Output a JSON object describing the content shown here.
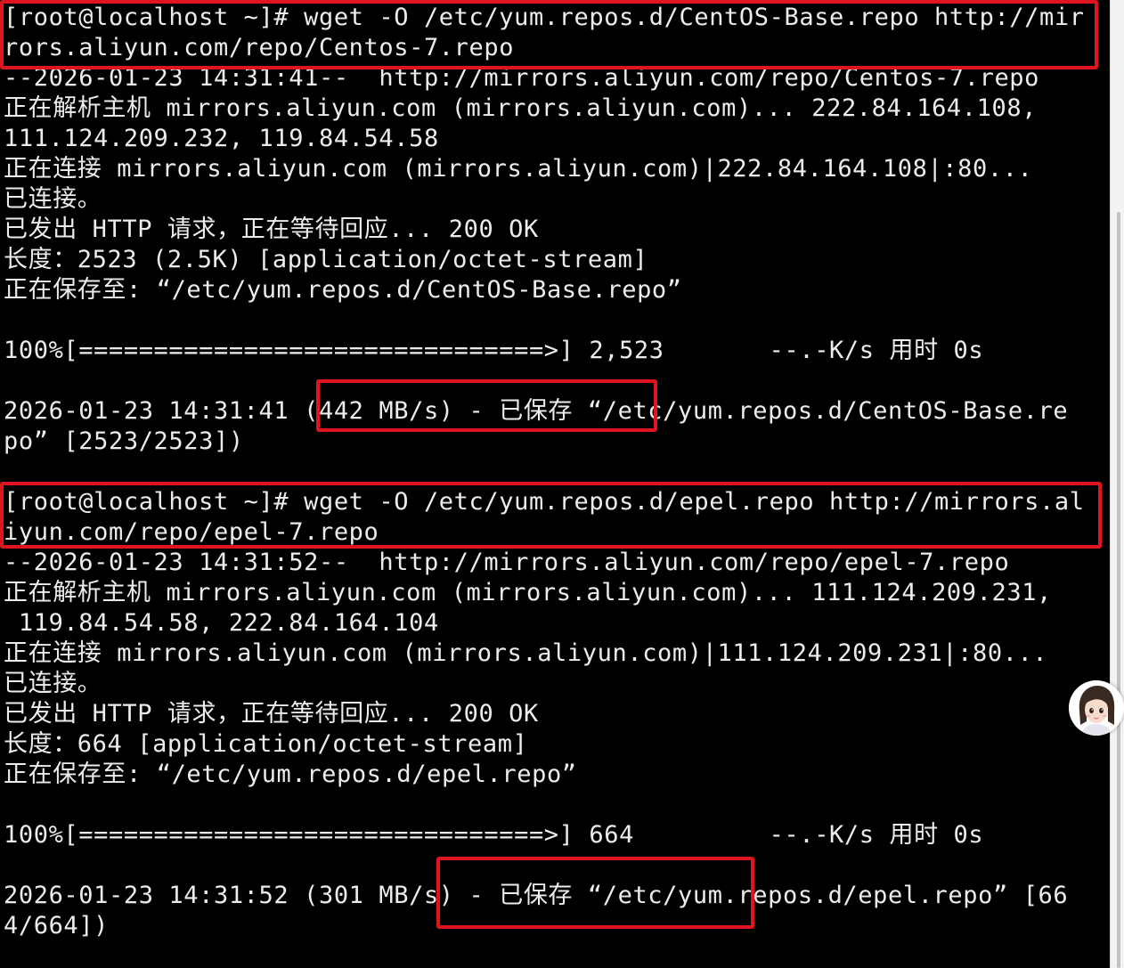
{
  "terminal": {
    "lines": [
      "[root@localhost ~]# wget -O /etc/yum.repos.d/CentOS-Base.repo http://mir",
      "rors.aliyun.com/repo/Centos-7.repo",
      "--2026-01-23 14:31:41--  http://mirrors.aliyun.com/repo/Centos-7.repo",
      "正在解析主机 mirrors.aliyun.com (mirrors.aliyun.com)... 222.84.164.108,",
      "111.124.209.232, 119.84.54.58",
      "正在连接 mirrors.aliyun.com (mirrors.aliyun.com)|222.84.164.108|:80...",
      "已连接。",
      "已发出 HTTP 请求，正在等待回应... 200 OK",
      "长度：2523 (2.5K) [application/octet-stream]",
      "正在保存至: “/etc/yum.repos.d/CentOS-Base.repo”",
      "",
      "100%[===============================>] 2,523       --.-K/s 用时 0s",
      "",
      "2026-01-23 14:31:41 (442 MB/s) - 已保存 “/etc/yum.repos.d/CentOS-Base.re",
      "po” [2523/2523])",
      "",
      "[root@localhost ~]# wget -O /etc/yum.repos.d/epel.repo http://mirrors.al",
      "iyun.com/repo/epel-7.repo",
      "--2026-01-23 14:31:52--  http://mirrors.aliyun.com/repo/epel-7.repo",
      "正在解析主机 mirrors.aliyun.com (mirrors.aliyun.com)... 111.124.209.231,",
      " 119.84.54.58, 222.84.164.104",
      "正在连接 mirrors.aliyun.com (mirrors.aliyun.com)|111.124.209.231|:80...",
      "已连接。",
      "已发出 HTTP 请求，正在等待回应... 200 OK",
      "长度：664 [application/octet-stream]",
      "正在保存至: “/etc/yum.repos.d/epel.repo”",
      "",
      "100%[===============================>] 664         --.-K/s 用时 0s",
      "",
      "2026-01-23 14:31:52 (301 MB/s) - 已保存 “/etc/yum.repos.d/epel.repo” [66",
      "4/664])"
    ],
    "colors": {
      "background": "#000000",
      "text": "#ececec",
      "highlight": "#e0141e"
    }
  },
  "icons": {
    "assistant_avatar": "assistant-avatar-icon"
  }
}
